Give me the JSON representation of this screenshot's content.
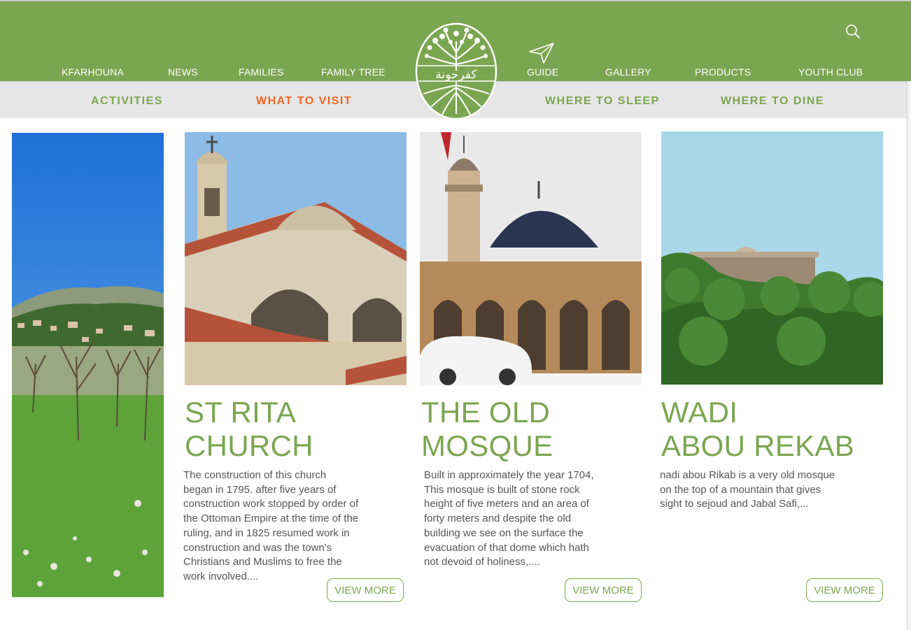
{
  "nav": {
    "items": [
      "KFARHOUNA",
      "NEWS",
      "FAMILIES",
      "FAMILY TREE",
      "GUIDE",
      "GALLERY",
      "PRODUCTS",
      "YOUTH CLUB"
    ],
    "search_icon": "search-icon",
    "guide_icon": "paper-plane-icon"
  },
  "logo": {
    "text": "كفرحونة"
  },
  "subnav": {
    "items": [
      "ACTIVITIES",
      "WHAT TO VISIT",
      "WHERE TO SLEEP",
      "WHERE TO DINE"
    ],
    "active": "WHAT TO VISIT"
  },
  "cards": [
    {
      "title_lines": [
        "ST RITA",
        "CHURCH"
      ],
      "text_lines": [
        "The construction of this church",
        "began  in 1795. after five years of",
        "construction work stopped by order of",
        "the Ottoman Empire at the time of the",
        "ruling, and in 1825 resumed work in",
        "construction and was the town's",
        "Christians and Muslims to free the",
        "work involved...."
      ],
      "button": "VIEW MORE"
    },
    {
      "title_lines": [
        "THE OLD",
        "MOSQUE"
      ],
      "text_lines": [
        "Built in approximately the year 1704,",
        "This mosque is built of stone rock",
        "height of five meters and an area of",
        "forty meters and despite the old",
        "building we see on the surface the",
        "evacuation of that dome which hath",
        "not devoid of holiness,...."
      ],
      "button": "VIEW MORE"
    },
    {
      "title_lines": [
        "WADI",
        "ABOU REKAB"
      ],
      "text_lines": [
        "nadi abou Rikab is a very old mosque",
        "on the top of a mountain that gives",
        "sight to sejoud and Jabal Safi,..."
      ],
      "button": "VIEW MORE"
    }
  ],
  "colors": {
    "brand_green": "#7ba651",
    "active_orange": "#f26522",
    "subbar_gray": "#e6e6e6"
  }
}
